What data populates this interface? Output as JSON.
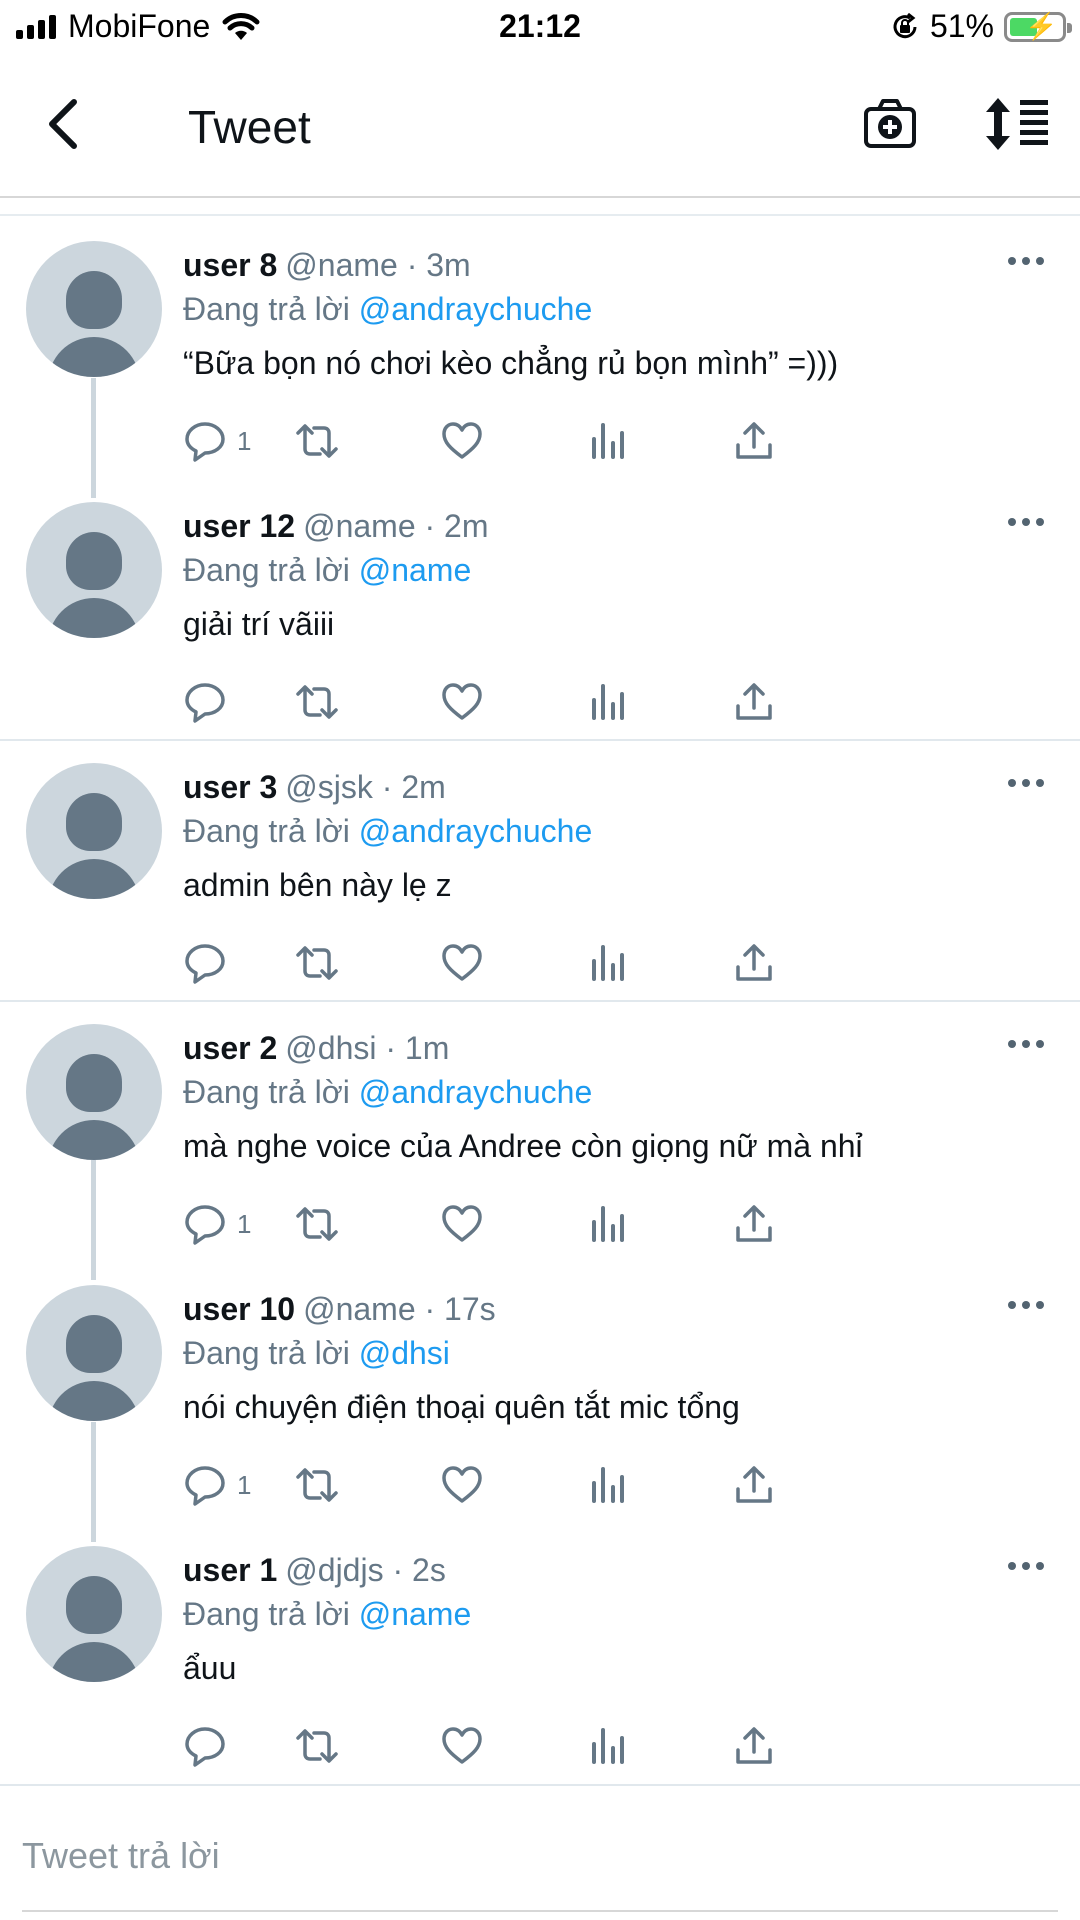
{
  "status_bar": {
    "carrier": "MobiFone",
    "time": "21:12",
    "battery": "51%",
    "battery_level": 0.51,
    "icons": [
      "signal-icon",
      "wifi-icon",
      "orientation-lock-icon",
      "battery-charging-icon"
    ]
  },
  "header": {
    "title": "Tweet",
    "icons": [
      "back-icon",
      "camera-add-icon",
      "sort-icon"
    ]
  },
  "tweets": [
    {
      "name": "user 8",
      "meta": "@name · 3m",
      "reply_prefix": "Đang trả lời",
      "reply_to": "@andraychuche",
      "text": "“Bữa bọn nó chơi kèo chẳng rủ bọn mình” =)))",
      "reply_count": "1"
    },
    {
      "name": "user 12",
      "meta": "@name · 2m",
      "reply_prefix": "Đang trả lời",
      "reply_to": "@name",
      "text": "giải trí vãiii",
      "reply_count": ""
    },
    {
      "name": "user 3",
      "meta": "@sjsk · 2m",
      "reply_prefix": "Đang trả lời",
      "reply_to": "@andraychuche",
      "text": "admin bên này lẹ z",
      "reply_count": ""
    },
    {
      "name": "user 2",
      "meta": "@dhsi · 1m",
      "reply_prefix": "Đang trả lời",
      "reply_to": "@andraychuche",
      "text": "mà nghe voice của Andree còn giọng nữ mà nhỉ",
      "reply_count": "1"
    },
    {
      "name": "user 10",
      "meta": "@name · 17s",
      "reply_prefix": "Đang trả lời",
      "reply_to": "@dhsi",
      "text": "nói chuyện điện thoại quên tắt mic tổng",
      "reply_count": "1"
    },
    {
      "name": "user 1",
      "meta": "@djdjs · 2s",
      "reply_prefix": "Đang trả lời",
      "reply_to": "@name",
      "text": "ẩuu",
      "reply_count": ""
    }
  ],
  "reply_bar": {
    "placeholder": "Tweet trả lời",
    "value": ""
  },
  "colors": {
    "link": "#1d9bf0",
    "secondary_text": "#657786",
    "avatar_bg": "#ccd6dd",
    "avatar_fg": "#657786"
  }
}
